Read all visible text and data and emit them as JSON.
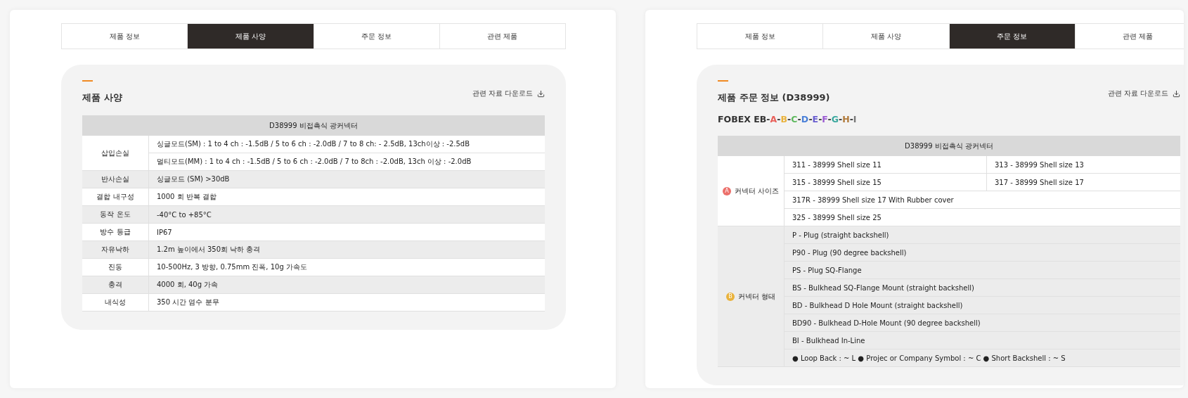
{
  "panels": [
    {
      "tabs": [
        {
          "label": "제품 정보",
          "selected": false
        },
        {
          "label": "제품 사양",
          "selected": true
        },
        {
          "label": "주문 정보",
          "selected": false
        },
        {
          "label": "관련 제품",
          "selected": false
        }
      ],
      "title": "제품 사양",
      "download": "관련 자료 다운로드",
      "table": {
        "caption": "D38999 비접촉식 광커넥터",
        "groups": [
          {
            "label": "삽입손실",
            "lines": [
              [
                "싱글모드(SM) : 1 to 4 ch : -1.5dB / 5 to 6 ch : -2.0dB / 7 to 8 ch: - 2.5dB, 13ch이상 : -2.5dB"
              ],
              [
                "멀티모드(MM) : 1 to 4 ch : -1.5dB / 5 to 6 ch : -2.0dB / 7 to 8ch : -2.0dB, 13ch 이상 : -2.0dB"
              ]
            ]
          },
          {
            "label": "반사손실",
            "lines": [
              [
                "싱글모드 (SM) >30dB"
              ]
            ]
          },
          {
            "label": "결합 내구성",
            "lines": [
              [
                "1000 회 반복 결합"
              ]
            ]
          },
          {
            "label": "동작 온도",
            "lines": [
              [
                "-40°C to +85°C"
              ]
            ]
          },
          {
            "label": "방수 등급",
            "lines": [
              [
                "IP67"
              ]
            ]
          },
          {
            "label": "자유낙하",
            "lines": [
              [
                "1.2m 높이에서 350회 낙하 충격"
              ]
            ]
          },
          {
            "label": "진동",
            "lines": [
              [
                "10-500Hz, 3 방향, 0.75mm 진폭, 10g 가속도"
              ]
            ]
          },
          {
            "label": "충격",
            "lines": [
              [
                "4000 회, 40g 가속"
              ]
            ]
          },
          {
            "label": "내식성",
            "lines": [
              [
                "350 시간 염수 분무"
              ]
            ]
          }
        ]
      }
    },
    {
      "tabs": [
        {
          "label": "제품 정보",
          "selected": false
        },
        {
          "label": "제품 사양",
          "selected": false
        },
        {
          "label": "주문 정보",
          "selected": true
        },
        {
          "label": "관련 제품",
          "selected": false
        }
      ],
      "title": "제품 주문 정보 (D38999)",
      "download": "관련 자료 다운로드",
      "code": {
        "prefix": "FOBEX EB",
        "separator": "-",
        "segments": [
          {
            "letter": "A",
            "color": "#e8625c"
          },
          {
            "letter": "B",
            "color": "#e9b23c"
          },
          {
            "letter": "C",
            "color": "#5cb85c"
          },
          {
            "letter": "D",
            "color": "#4a80d8"
          },
          {
            "letter": "E",
            "color": "#6a5fd0"
          },
          {
            "letter": "F",
            "color": "#9b5bd2"
          },
          {
            "letter": "G",
            "color": "#3aa89e"
          },
          {
            "letter": "H",
            "color": "#b07a3a"
          },
          {
            "letter": "I",
            "color": "#777777"
          }
        ]
      },
      "table": {
        "caption": "D38999 비접촉식 광커넥터",
        "groups": [
          {
            "badge": {
              "letter": "A",
              "color": "#ec6f6a"
            },
            "label": "커넥터 사이즈",
            "lines": [
              [
                "311 - 38999 Shell size 11",
                "313 - 38999 Shell size 13"
              ],
              [
                "315 - 38999 Shell size 15",
                "317 - 38999 Shell size 17"
              ],
              [
                "317R - 38999 Shell size 17 With Rubber cover"
              ],
              [
                "325 - 38999 Shell size 25"
              ]
            ]
          },
          {
            "badge": {
              "letter": "B",
              "color": "#e9b23c"
            },
            "label": "커넥터 형태",
            "lines": [
              [
                "P - Plug (straight backshell)"
              ],
              [
                "P90 - Plug (90 degree backshell)"
              ],
              [
                "PS - Plug SQ-Flange"
              ],
              [
                "BS - Bulkhead SQ-Flange Mount (straight backshell)"
              ],
              [
                "BD - Bulkhead D Hole Mount (straight backshell)"
              ],
              [
                "BD90 - Bulkhead D-Hole Mount (90 degree backshell)"
              ],
              [
                "BI - Bulkhead In-Line"
              ],
              [
                "● Loop Back : ~ L ● Projec or Company Symbol : ~ C ● Short Backshell : ~ S"
              ]
            ]
          }
        ]
      }
    }
  ]
}
